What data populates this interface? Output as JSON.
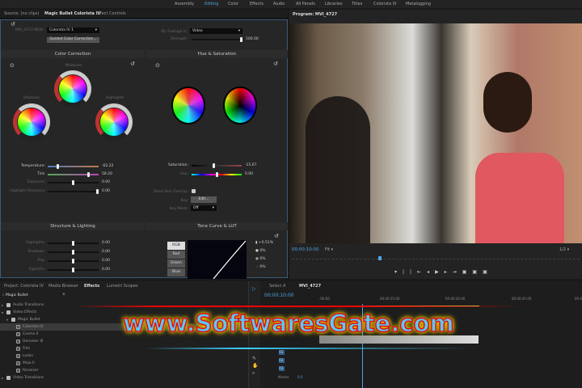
{
  "workspace_tabs": [
    "Assembly",
    "Editing",
    "Color",
    "Effects",
    "Audio",
    "All Panels",
    "Libraries",
    "Titles",
    "Colorista IV",
    "Metalogging"
  ],
  "active_workspace": "Editing",
  "left_tabs": [
    "Source: (no clips)",
    "Magic Bullet Colorista IV",
    "Effect Controls"
  ],
  "clip_label": "MVI_4727.MOV:",
  "preset": "Colorista IV 1",
  "guided_button": "Guided Color Correction...",
  "footage_label": "My Footage is:",
  "footage_value": "Video",
  "strength_label": "Strength:",
  "strength_value": "100.00",
  "strength": 1.0,
  "color_correction": {
    "title": "Color Correction",
    "midtones": "Midtones",
    "shadows": "Shadows",
    "highlights": "Highlights",
    "sliders": [
      {
        "label": "Temperature:",
        "value": "-62.22",
        "pos": 0.19
      },
      {
        "label": "Tint:",
        "value": "58.20",
        "pos": 0.79
      },
      {
        "label": "Exposure:",
        "value": "0.00",
        "pos": 0.5
      },
      {
        "label": "Highlight Recovery:",
        "value": "0.00",
        "pos": 1.0
      }
    ]
  },
  "hue_saturation": {
    "title": "Hue & Saturation",
    "sliders": [
      {
        "label": "Saturation:",
        "value": "-15.67",
        "pos": 0.42
      },
      {
        "label": "Hue:",
        "value": "0.00",
        "pos": 0.5
      }
    ],
    "skin_overlay": "Show Skin Overlay:",
    "key_label": "Key:",
    "key_button": "Edit...",
    "key_mode_label": "Key Mode:",
    "key_mode": "Off"
  },
  "structure": {
    "title": "Structure & Lighting",
    "sliders": [
      {
        "label": "Highlights:",
        "value": "0.00"
      },
      {
        "label": "Shadows:",
        "value": "0.00"
      },
      {
        "label": "Pop:",
        "value": "0.00"
      },
      {
        "label": "Vignette:",
        "value": "0.00"
      }
    ]
  },
  "tone_curve": {
    "title": "Tone Curve & LUT",
    "channels": [
      "RGB",
      "Red",
      "Green",
      "Blue"
    ],
    "active": "RGB",
    "readouts": [
      "+0.51%",
      "0%",
      "0%",
      "0%"
    ]
  },
  "program": {
    "title": "Program: MVI_4727",
    "timecode": "00:00:10:00",
    "fit": "Fit",
    "resolution": "1/2"
  },
  "bottom_tabs": [
    "Project: Colorista IV",
    "Media Browser",
    "Effects",
    "Lumetri Scopes"
  ],
  "active_bottom_tab": "Effects",
  "search_value": "Magic Bullet",
  "effects_tree": [
    {
      "label": "Audio Transitions",
      "level": 0
    },
    {
      "label": "Video Effects",
      "level": 0
    },
    {
      "label": "Magic Bullet",
      "level": 1
    },
    {
      "label": "Colorista IV",
      "level": 2,
      "selected": true
    },
    {
      "label": "Cosmo II",
      "level": 2
    },
    {
      "label": "Denoiser III",
      "level": 2
    },
    {
      "label": "Film",
      "level": 2
    },
    {
      "label": "Looks",
      "level": 2
    },
    {
      "label": "Mojo II",
      "level": 2
    },
    {
      "label": "Renoiser",
      "level": 2
    },
    {
      "label": "Video Transitions",
      "level": 0
    }
  ],
  "timeline": {
    "tabs": [
      "Select A",
      "MVI_4727"
    ],
    "timecode": "00:00:10:00",
    "ruler": [
      ":00:00",
      "00:00:15:00",
      "00:00:30:00",
      "00:00:45:00",
      "00:0"
    ],
    "tracks": [
      "A1",
      "A2",
      "A3"
    ],
    "master": "Master",
    "master_val": "0.0"
  },
  "watermark": "www.SoftwaresGate.com",
  "colors": {
    "accent": "#4ea3e0",
    "bg": "#262626",
    "watermark_fill": "#5bc8f5",
    "watermark_glow": "#e8c000"
  }
}
